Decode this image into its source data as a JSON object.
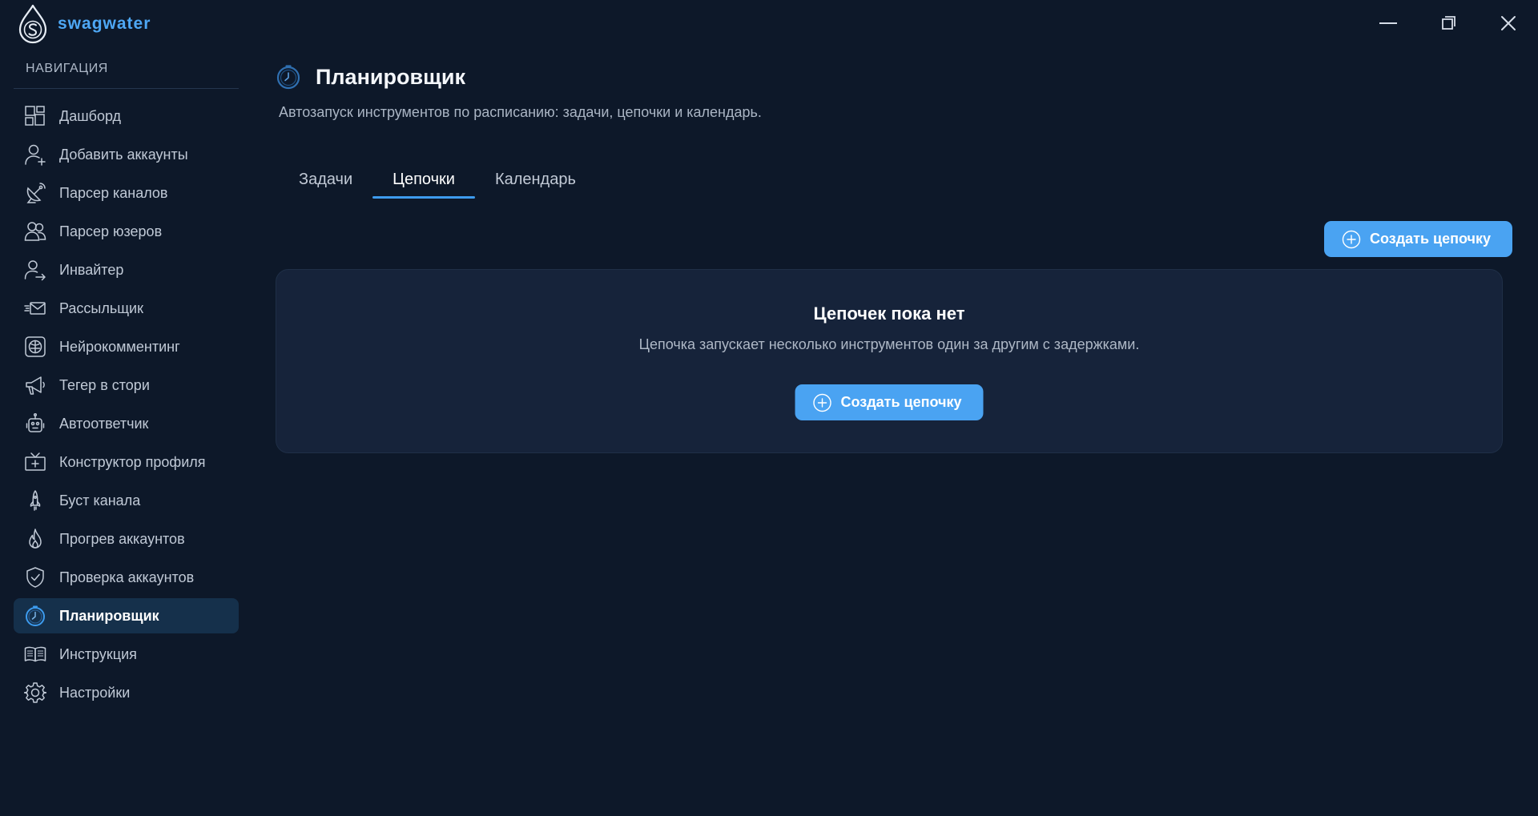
{
  "app": {
    "name": "swagwater",
    "accent_color": "#4ea8f5",
    "background_color": "#0d1829"
  },
  "window_controls": [
    {
      "name": "minimize-button",
      "icon": "minimize-icon"
    },
    {
      "name": "maximize-button",
      "icon": "restore-icon"
    },
    {
      "name": "close-button",
      "icon": "close-icon"
    }
  ],
  "sidebar": {
    "heading": "НАВИГАЦИЯ",
    "items": [
      {
        "label": "Дашборд",
        "icon": "dashboard-icon",
        "active": false
      },
      {
        "label": "Добавить аккаунты",
        "icon": "user-plus-icon",
        "active": false
      },
      {
        "label": "Парсер каналов",
        "icon": "satellite-dish-icon",
        "active": false
      },
      {
        "label": "Парсер юзеров",
        "icon": "users-icon",
        "active": false
      },
      {
        "label": "Инвайтер",
        "icon": "user-arrow-icon",
        "active": false
      },
      {
        "label": "Рассыльщик",
        "icon": "envelope-icon",
        "active": false
      },
      {
        "label": "Нейрокомментинг",
        "icon": "brain-icon",
        "active": false
      },
      {
        "label": "Тегер в стори",
        "icon": "megaphone-icon",
        "active": false
      },
      {
        "label": "Автоответчик",
        "icon": "robot-icon",
        "active": false
      },
      {
        "label": "Конструктор профиля",
        "icon": "tv-plus-icon",
        "active": false
      },
      {
        "label": "Буст канала",
        "icon": "rocket-icon",
        "active": false
      },
      {
        "label": "Прогрев аккаунтов",
        "icon": "flame-icon",
        "active": false
      },
      {
        "label": "Проверка аккаунтов",
        "icon": "shield-check-icon",
        "active": false
      },
      {
        "label": "Планировщик",
        "icon": "clock-icon",
        "active": true
      },
      {
        "label": "Инструкция",
        "icon": "book-icon",
        "active": false
      },
      {
        "label": "Настройки",
        "icon": "gear-icon",
        "active": false
      }
    ]
  },
  "page": {
    "title": "Планировщик",
    "icon": "clock-icon",
    "subtitle": "Автозапуск инструментов по расписанию: задачи, цепочки и календарь."
  },
  "tabs": [
    {
      "label": "Задачи",
      "active": false
    },
    {
      "label": "Цепочки",
      "active": true
    },
    {
      "label": "Календарь",
      "active": false
    }
  ],
  "toolbar": {
    "create_label": "Создать цепочку",
    "create_icon": "plus-circle-icon"
  },
  "empty_state": {
    "title": "Цепочек пока нет",
    "description": "Цепочка запускает несколько инструментов один за другим с задержками.",
    "button_label": "Создать цепочку"
  }
}
